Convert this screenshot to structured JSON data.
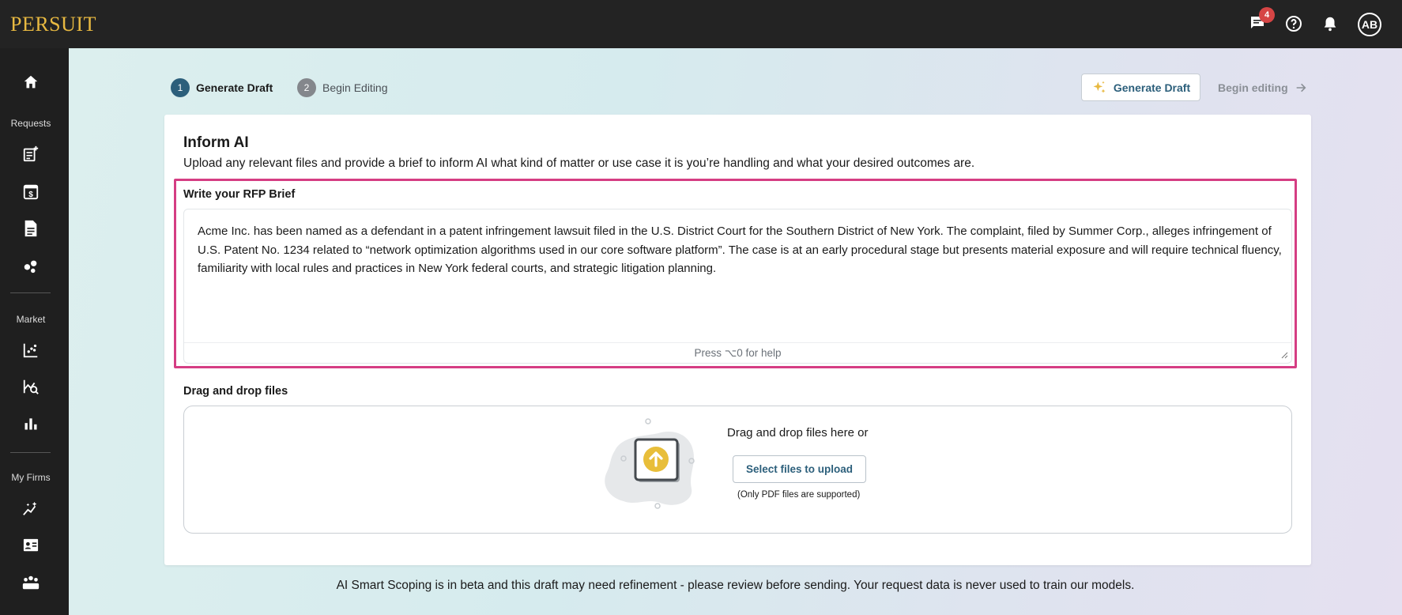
{
  "app": {
    "logo": "PERSUIT"
  },
  "topbar": {
    "messages_badge": "4",
    "icons": [
      "chat-icon",
      "help-icon",
      "bell-icon"
    ],
    "avatar_initials": "AB"
  },
  "sidebar": {
    "section_requests": "Requests",
    "section_market": "Market",
    "section_firms": "My Firms",
    "icons": [
      "home-icon",
      "new-request-icon",
      "calendar-dollar-icon",
      "document-icon",
      "molecule-icon",
      "scatter-chart-icon",
      "analysis-icon",
      "bar-chart-icon",
      "sparkle-trend-icon",
      "contact-card-icon",
      "team-icon"
    ]
  },
  "steps": [
    {
      "number": "1",
      "label": "Generate Draft",
      "active": true
    },
    {
      "number": "2",
      "label": "Begin Editing",
      "active": false
    }
  ],
  "actions": {
    "generate_label": "Generate Draft",
    "begin_label": "Begin editing"
  },
  "card": {
    "title": "Inform AI",
    "description": "Upload any relevant files and provide a brief to inform AI what kind of matter or use case it is you’re handling and what your desired outcomes are."
  },
  "brief": {
    "label": "Write your RFP Brief",
    "text": "Acme Inc. has been named as a defendant in a patent infringement lawsuit filed in the U.S. District Court for the Southern District of New York. The complaint, filed by Summer Corp., alleges infringement of U.S. Patent No. 1234 related to “network optimization algorithms used in our core software platform”. The case is at an early procedural stage but presents material exposure and will require technical fluency, familiarity with local rules and practices in New York federal courts, and strategic litigation planning.",
    "help": "Press ⌥0 for help"
  },
  "upload": {
    "label": "Drag and drop files",
    "drop_text": "Drag and drop files here or",
    "button": "Select files to upload",
    "note": "(Only PDF files are supported)"
  },
  "footer": {
    "note": "AI Smart Scoping is in beta and this draft may need refinement - please review before sending. Your request data is never used to train our models."
  },
  "colors": {
    "accent_blue": "#2c5f7b",
    "highlight_pink": "#d53d83",
    "logo_gold": "#e8b941",
    "badge_red": "#d64545",
    "upload_yellow": "#e8be3a"
  }
}
